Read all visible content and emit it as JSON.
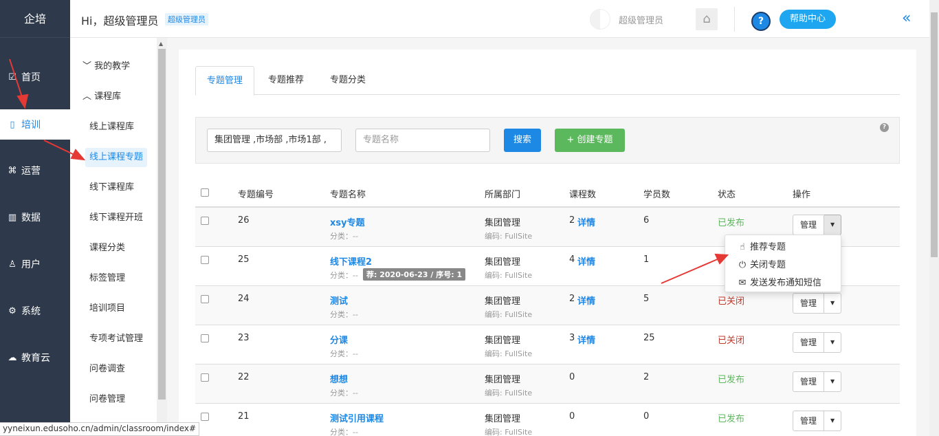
{
  "brand": "企培",
  "nav": [
    {
      "label": "首页",
      "icon": "chart-icon"
    },
    {
      "label": "培训",
      "icon": "book-icon"
    },
    {
      "label": "运营",
      "icon": "command-icon"
    },
    {
      "label": "数据",
      "icon": "bar-chart-icon"
    },
    {
      "label": "用户",
      "icon": "user-icon"
    },
    {
      "label": "系统",
      "icon": "gear-icon"
    },
    {
      "label": "教育云",
      "icon": "cloud-icon"
    }
  ],
  "subnav": {
    "groups": [
      {
        "label": "我的教学",
        "chevron": "﹀"
      },
      {
        "label": "课程库",
        "chevron": "︿"
      }
    ],
    "items": [
      "线上课程库",
      "线上课程专题",
      "线下课程库",
      "线下课程开班",
      "课程分类",
      "标签管理",
      "培训项目",
      "专项考试管理",
      "问卷调查",
      "问卷管理"
    ]
  },
  "header": {
    "greeting": "Hi，超级管理员",
    "role_badge": "超级管理员",
    "user_name": "超级管理员",
    "help_center": "帮助中心",
    "help_symbol": "?",
    "collapse_symbol": "«",
    "home_symbol": "⌂"
  },
  "tabs": [
    "专题管理",
    "专题推荐",
    "专题分类"
  ],
  "filter": {
    "dept_value": "集团管理 ,市场部 ,市场1部 ,",
    "name_placeholder": "专题名称",
    "search_label": "搜索",
    "create_label": "+ 创建专题",
    "help_symbol": "?"
  },
  "table": {
    "headers": [
      "专题编号",
      "专题名称",
      "所属部门",
      "课程数",
      "学员数",
      "状态",
      "操作"
    ],
    "rows": [
      {
        "id": "26",
        "name": "xsy专题",
        "category": "分类：--",
        "dept": "集团管理",
        "code": "编码: FullSite",
        "courses": "2",
        "detail": "详情",
        "students": "6",
        "status": "已发布",
        "status_type": "on",
        "manage": "管理",
        "caret": "▼"
      },
      {
        "id": "25",
        "name": "线下课程2",
        "category": "分类：--",
        "tag": "荐: 2020-06-23 / 序号: 1",
        "dept": "集团管理",
        "code": "编码: FullSite",
        "courses": "4",
        "detail": "详情",
        "students": "1",
        "status": "",
        "status_type": "",
        "manage": "",
        "caret": ""
      },
      {
        "id": "24",
        "name": "测试",
        "category": "分类：--",
        "dept": "集团管理",
        "code": "编码: FullSite",
        "courses": "2",
        "detail": "详情",
        "students": "5",
        "status": "已关闭",
        "status_type": "off",
        "manage": "管理",
        "caret": "▼"
      },
      {
        "id": "23",
        "name": "分课",
        "category": "分类：--",
        "dept": "集团管理",
        "code": "编码: FullSite",
        "courses": "3",
        "detail": "详情",
        "students": "25",
        "status": "已关闭",
        "status_type": "off",
        "manage": "管理",
        "caret": "▼"
      },
      {
        "id": "22",
        "name": "想想",
        "category": "分类：--",
        "dept": "集团管理",
        "code": "编码: FullSite",
        "courses": "0",
        "detail": "",
        "students": "2",
        "status": "已发布",
        "status_type": "on",
        "manage": "管理",
        "caret": "▼"
      },
      {
        "id": "21",
        "name": "测试引用课程",
        "category": "分类：--",
        "dept": "集团管理",
        "code": "编码: FullSite",
        "courses": "0",
        "detail": "",
        "students": "0",
        "status": "已发布",
        "status_type": "on",
        "manage": "管理",
        "caret": "▼"
      }
    ]
  },
  "dropdown": {
    "items": [
      {
        "label": "推荐专题",
        "icon": "hand-pointer-icon",
        "glyph": "☝"
      },
      {
        "label": "关闭专题",
        "icon": "power-icon",
        "glyph": "⏻"
      },
      {
        "label": "发送发布通知短信",
        "icon": "envelope-icon",
        "glyph": "✉"
      }
    ]
  },
  "status_url": "yyneixun.edusoho.cn/admin/classroom/index#",
  "colors": {
    "primary": "#1e88e5",
    "success": "#5cb85c",
    "danger": "#c0392b",
    "sidebar": "#2e3a4b",
    "annotation": "#e53935"
  }
}
